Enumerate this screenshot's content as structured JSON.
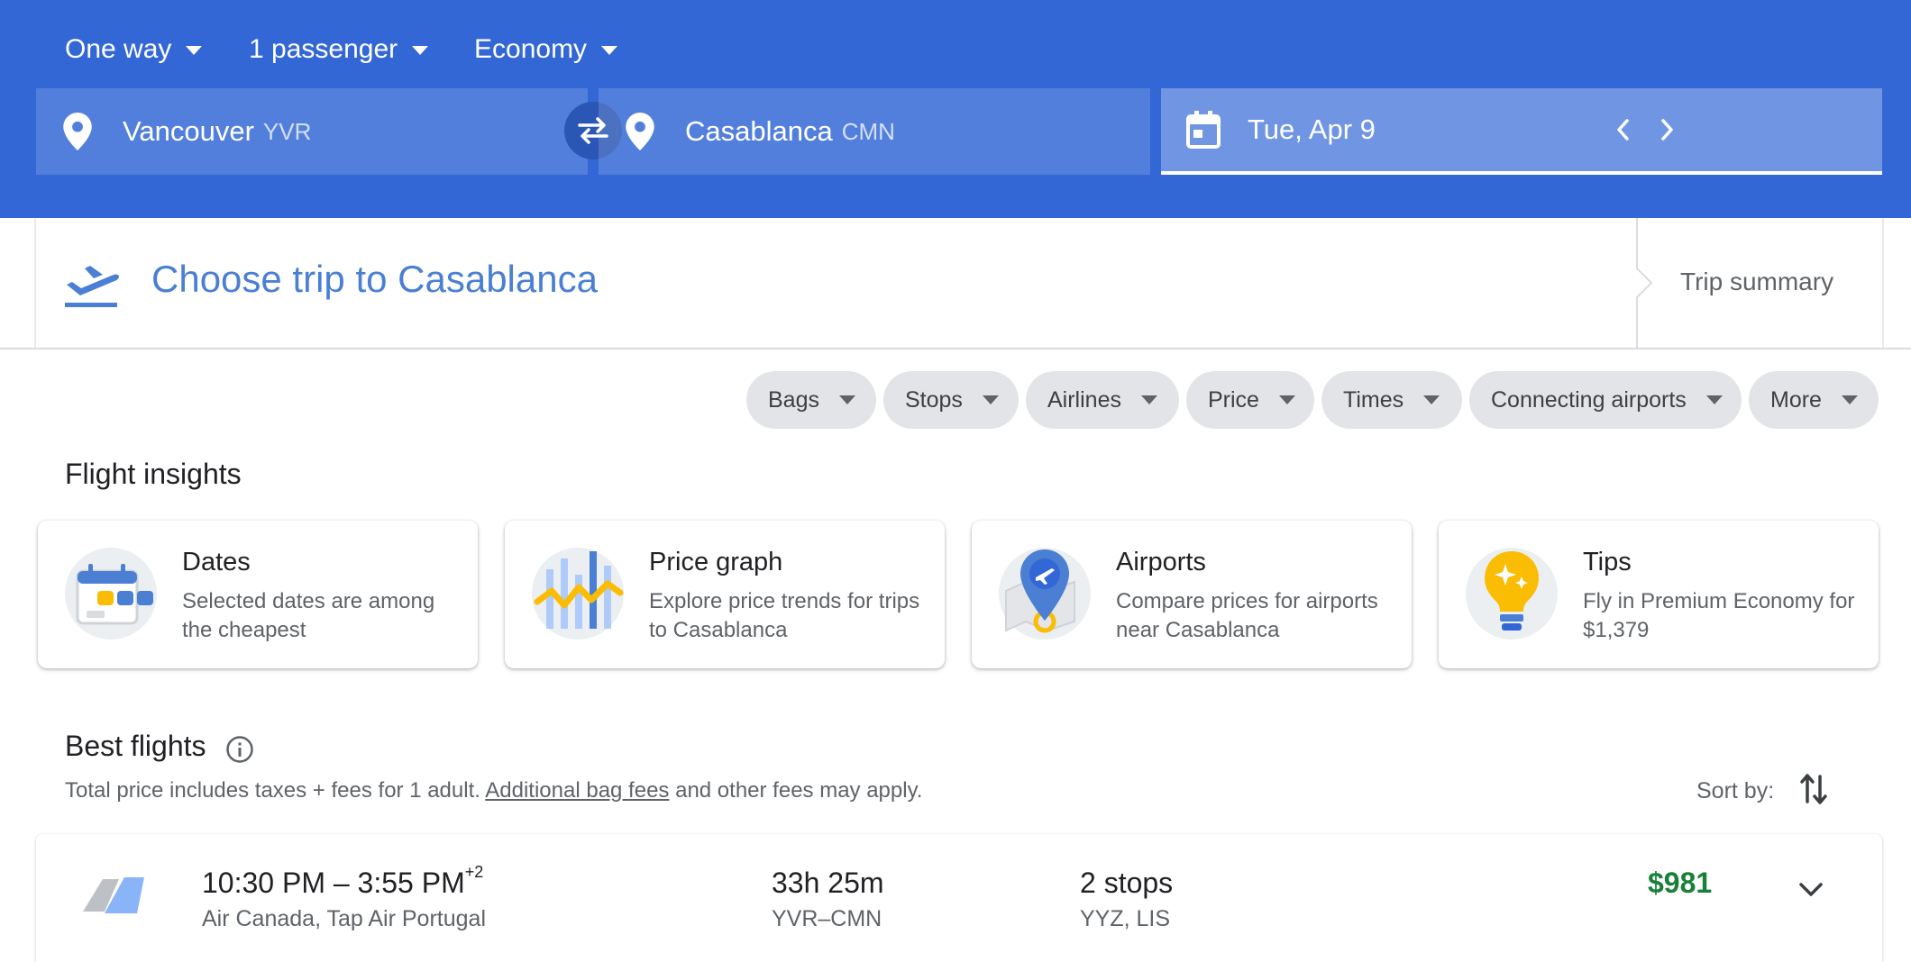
{
  "search": {
    "trip_type": "One way",
    "passengers": "1 passenger",
    "cabin": "Economy",
    "origin_city": "Vancouver",
    "origin_code": "YVR",
    "destination_city": "Casablanca",
    "destination_code": "CMN",
    "date": "Tue, Apr 9"
  },
  "trip": {
    "title": "Choose trip to Casablanca",
    "summary_label": "Trip summary"
  },
  "filters": [
    "Bags",
    "Stops",
    "Airlines",
    "Price",
    "Times",
    "Connecting airports",
    "More"
  ],
  "insights": {
    "heading": "Flight insights",
    "cards": [
      {
        "title": "Dates",
        "description": "Selected dates are among the cheapest",
        "icon": "calendar-illustration"
      },
      {
        "title": "Price graph",
        "description": "Explore price trends for trips to Casablanca",
        "icon": "price-graph-illustration"
      },
      {
        "title": "Airports",
        "description": "Compare prices for airports near Casablanca",
        "icon": "airport-pin-illustration"
      },
      {
        "title": "Tips",
        "description": "Fly in Premium Economy for $1,379",
        "icon": "lightbulb-illustration"
      }
    ]
  },
  "best_flights": {
    "heading": "Best flights",
    "note_prefix": "Total price includes taxes + fees for 1 adult. ",
    "note_link": "Additional bag fees",
    "note_suffix": " and other fees may apply.",
    "sort_label": "Sort by:",
    "flights": [
      {
        "times": "10:30 PM – 3:55 PM",
        "day_offset": "+2",
        "airlines": "Air Canada, Tap Air Portugal",
        "duration": "33h 25m",
        "route": "YVR–CMN",
        "stops": "2 stops",
        "via": "YYZ, LIS",
        "price": "$981"
      }
    ]
  },
  "colors": {
    "header_bg": "#3367d6",
    "title_blue": "#4a7fd4",
    "price_green": "#188038",
    "chip_bg": "#e3e4e8"
  }
}
